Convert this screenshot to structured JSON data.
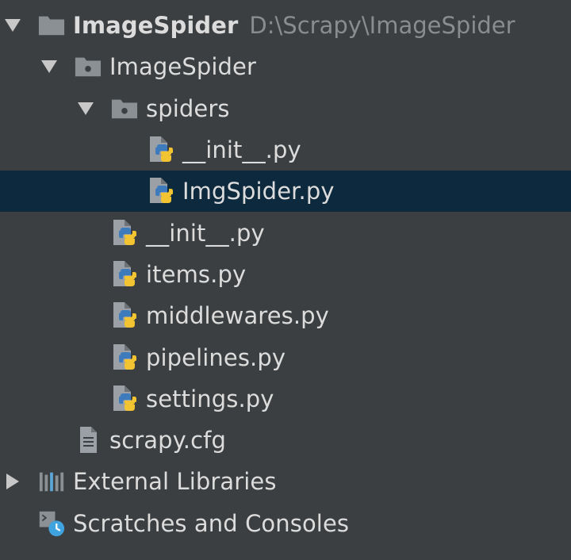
{
  "project_tree": {
    "root": {
      "name": "ImageSpider",
      "path": "D:\\Scrapy\\ImageSpider"
    },
    "package": {
      "name": "ImageSpider"
    },
    "spiders_folder": {
      "name": "spiders"
    },
    "spiders_files": [
      {
        "name": "__init__.py"
      },
      {
        "name": "ImgSpider.py"
      }
    ],
    "package_files": [
      {
        "name": "__init__.py"
      },
      {
        "name": "items.py"
      },
      {
        "name": "middlewares.py"
      },
      {
        "name": "pipelines.py"
      },
      {
        "name": "settings.py"
      }
    ],
    "config_file": {
      "name": "scrapy.cfg"
    },
    "external_libraries": {
      "name": "External Libraries"
    },
    "scratches": {
      "name": "Scratches and Consoles"
    },
    "selected_item": "ImgSpider.py"
  },
  "colors": {
    "background": "#3c3f41",
    "selection": "#0d293e",
    "text": "#dcdcdc",
    "path_text": "#8a8c8e"
  },
  "icons": {
    "expanded_arrow": "triangle-down-icon",
    "collapsed_arrow": "triangle-right-icon",
    "folder": "folder-icon",
    "package": "package-folder-icon",
    "python_file": "python-file-icon",
    "text_file": "text-file-icon",
    "libraries": "libraries-icon",
    "scratches": "scratches-icon"
  }
}
